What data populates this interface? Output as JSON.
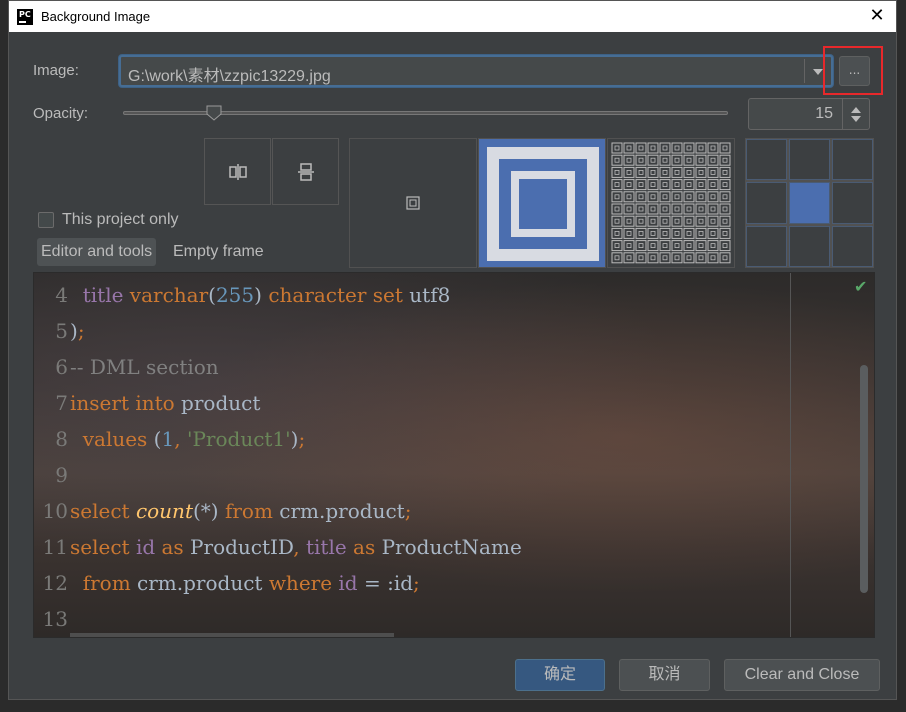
{
  "dialog": {
    "title": "Background Image",
    "app_icon": "PC"
  },
  "image_field": {
    "label": "Image:",
    "value": "G:\\work\\素材\\zzpic13229.jpg",
    "browse_label": "..."
  },
  "opacity": {
    "label": "Opacity:",
    "value": "15",
    "level_fraction": 0.15
  },
  "options": {
    "this_project_only": "This project only",
    "this_project_only_checked": false
  },
  "tabs": [
    {
      "label": "Editor and tools",
      "active": true
    },
    {
      "label": "Empty frame",
      "active": false
    }
  ],
  "fill_modes": [
    "plain",
    "scale",
    "tile"
  ],
  "fill_mode_selected": "scale",
  "anchor_selected": "center",
  "preview": {
    "lines": [
      {
        "n": "4",
        "tokens": [
          [
            "plain",
            "  "
          ],
          [
            "id",
            "title"
          ],
          [
            "plain",
            " "
          ],
          [
            "kw",
            "varchar"
          ],
          [
            "plain",
            "("
          ],
          [
            "num",
            "255"
          ],
          [
            "plain",
            ") "
          ],
          [
            "kw",
            "character set"
          ],
          [
            "plain",
            " utf8"
          ]
        ]
      },
      {
        "n": "5",
        "tokens": [
          [
            "plain",
            ")"
          ],
          [
            "kw",
            ";"
          ]
        ]
      },
      {
        "n": "6",
        "tokens": [
          [
            "cmt",
            "-- DML section"
          ]
        ]
      },
      {
        "n": "7",
        "tokens": [
          [
            "kw",
            "insert into"
          ],
          [
            "plain",
            " product"
          ]
        ]
      },
      {
        "n": "8",
        "tokens": [
          [
            "plain",
            "  "
          ],
          [
            "kw",
            "values"
          ],
          [
            "plain",
            " ("
          ],
          [
            "num",
            "1"
          ],
          [
            "kw",
            ","
          ],
          [
            "plain",
            " "
          ],
          [
            "str",
            "'Product1'"
          ],
          [
            "plain",
            ")"
          ],
          [
            "kw",
            ";"
          ]
        ]
      },
      {
        "n": "9",
        "tokens": []
      },
      {
        "n": "10",
        "tokens": [
          [
            "kw",
            "select"
          ],
          [
            "plain",
            " "
          ],
          [
            "fn",
            "count"
          ],
          [
            "plain",
            "(*) "
          ],
          [
            "kw",
            "from"
          ],
          [
            "plain",
            " crm.product"
          ],
          [
            "kw",
            ";"
          ]
        ]
      },
      {
        "n": "11",
        "tokens": [
          [
            "kw",
            "select"
          ],
          [
            "plain",
            " "
          ],
          [
            "id",
            "id"
          ],
          [
            "plain",
            " "
          ],
          [
            "kw",
            "as"
          ],
          [
            "plain",
            " ProductID"
          ],
          [
            "kw",
            ","
          ],
          [
            "plain",
            " "
          ],
          [
            "id",
            "title"
          ],
          [
            "plain",
            " "
          ],
          [
            "kw",
            "as"
          ],
          [
            "plain",
            " ProductName"
          ]
        ]
      },
      {
        "n": "12",
        "tokens": [
          [
            "plain",
            "  "
          ],
          [
            "kw",
            "from"
          ],
          [
            "plain",
            " crm.product "
          ],
          [
            "kw",
            "where"
          ],
          [
            "plain",
            " "
          ],
          [
            "id",
            "id"
          ],
          [
            "plain",
            " = :id"
          ],
          [
            "kw",
            ";"
          ]
        ]
      },
      {
        "n": "13",
        "tokens": []
      }
    ]
  },
  "buttons": {
    "ok": "确定",
    "cancel": "取消",
    "clear_close": "Clear and Close"
  }
}
